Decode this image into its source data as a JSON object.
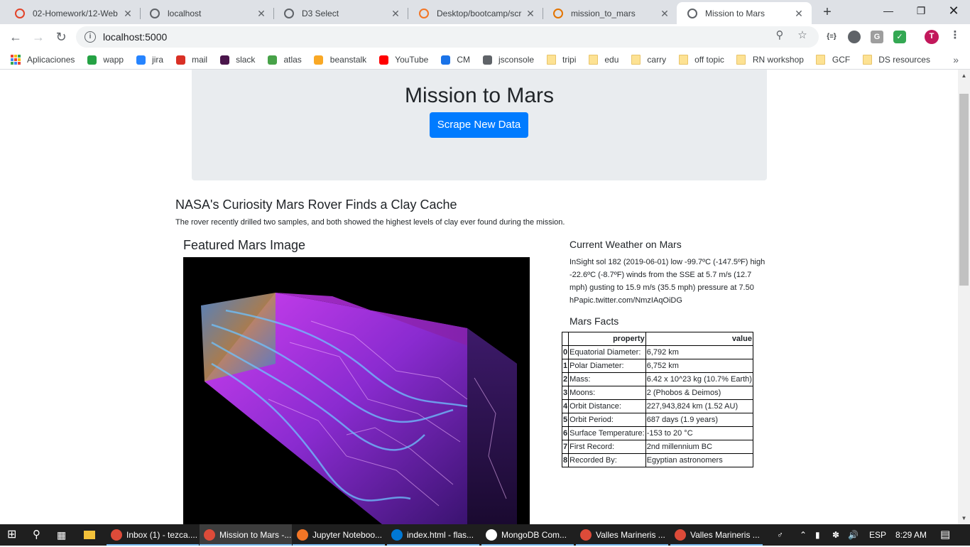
{
  "browser": {
    "tabs": [
      {
        "label": "02-Homework/12-Web",
        "icon": "gitlab-icon",
        "color": "#e24329"
      },
      {
        "label": "localhost",
        "icon": "globe-icon",
        "color": "#5f6368"
      },
      {
        "label": "D3 Select",
        "icon": "globe-icon",
        "color": "#5f6368"
      },
      {
        "label": "Desktop/bootcamp/scr",
        "icon": "jupyter-icon",
        "color": "#f37626"
      },
      {
        "label": "mission_to_mars",
        "icon": "notebook-icon",
        "color": "#e37400"
      },
      {
        "label": "Mission to Mars",
        "icon": "globe-icon",
        "color": "#5f6368"
      }
    ],
    "active_tab": 5,
    "url": "localhost:5000",
    "bookmarks": [
      {
        "label": "Aplicaciones",
        "icon": "apps-grid-icon",
        "color": "#4285f4"
      },
      {
        "label": "wapp",
        "icon": "whatsapp-icon",
        "color": "#25a244"
      },
      {
        "label": "jira",
        "icon": "jira-icon",
        "color": "#2684ff"
      },
      {
        "label": "mail",
        "icon": "gmail-icon",
        "color": "#d93025"
      },
      {
        "label": "slack",
        "icon": "slack-icon",
        "color": "#4a154b"
      },
      {
        "label": "atlas",
        "icon": "mongodb-leaf-icon",
        "color": "#47a248"
      },
      {
        "label": "beanstalk",
        "icon": "beanstalk-box-icon",
        "color": "#f9a825"
      },
      {
        "label": "YouTube",
        "icon": "youtube-icon",
        "color": "#ff0000"
      },
      {
        "label": "CM",
        "icon": "cm-icon",
        "color": "#1a73e8"
      },
      {
        "label": "jsconsole",
        "icon": "globe-icon",
        "color": "#5f6368"
      },
      {
        "label": "tripi",
        "icon": "folder-icon",
        "color": "#fde293"
      },
      {
        "label": "edu",
        "icon": "folder-icon",
        "color": "#fde293"
      },
      {
        "label": "carry",
        "icon": "folder-icon",
        "color": "#fde293"
      },
      {
        "label": "off topic",
        "icon": "folder-icon",
        "color": "#fde293"
      },
      {
        "label": "RN workshop",
        "icon": "folder-icon",
        "color": "#fde293"
      },
      {
        "label": "GCF",
        "icon": "folder-icon",
        "color": "#fde293"
      },
      {
        "label": "DS resources",
        "icon": "folder-icon",
        "color": "#fde293"
      }
    ],
    "profile_initial": "T"
  },
  "page": {
    "title": "Mission to Mars",
    "scrape_button": "Scrape New Data",
    "news_title": "NASA's Curiosity Mars Rover Finds a Clay Cache",
    "news_paragraph": "The rover recently drilled two samples, and both showed the highest levels of clay ever found during the mission.",
    "featured_heading": "Featured Mars Image",
    "weather_heading": "Current Weather on Mars",
    "weather_lines": [
      "InSight sol 182 (2019-06-01) low -99.7ºC (-147.5ºF) high",
      "-22.6ºC (-8.7ºF) winds from the SSE at 5.7 m/s (12.7",
      "mph) gusting to 15.9 m/s (35.5 mph) pressure at 7.50",
      "hPapic.twitter.com/NmzIAqOiDG"
    ],
    "facts_heading": "Mars Facts",
    "facts_columns": [
      "property",
      "value"
    ],
    "facts": [
      {
        "index": "0",
        "property": "Equatorial Diameter:",
        "value": "6,792 km"
      },
      {
        "index": "1",
        "property": "Polar Diameter:",
        "value": "6,752 km"
      },
      {
        "index": "2",
        "property": "Mass:",
        "value": "6.42 x 10^23 kg (10.7% Earth)"
      },
      {
        "index": "3",
        "property": "Moons:",
        "value": "2 (Phobos & Deimos)"
      },
      {
        "index": "4",
        "property": "Orbit Distance:",
        "value": "227,943,824 km (1.52 AU)"
      },
      {
        "index": "5",
        "property": "Orbit Period:",
        "value": "687 days (1.9 years)"
      },
      {
        "index": "6",
        "property": "Surface Temperature:",
        "value": "-153 to 20 °C"
      },
      {
        "index": "7",
        "property": "First Record:",
        "value": "2nd millennium BC"
      },
      {
        "index": "8",
        "property": "Recorded By:",
        "value": "Egyptian astronomers"
      }
    ]
  },
  "taskbar": {
    "items": [
      {
        "label": "Inbox (1) - tezca....",
        "icon": "chrome-icon",
        "color": "#dd4b39",
        "active": false
      },
      {
        "label": "Mission to Mars -...",
        "icon": "chrome-icon",
        "color": "#dd4b39",
        "active": true
      },
      {
        "label": "Jupyter Noteboo...",
        "icon": "jupyter-icon",
        "color": "#f37626",
        "active": false
      },
      {
        "label": "index.html - flas...",
        "icon": "vscode-icon",
        "color": "#0078d4",
        "active": false
      },
      {
        "label": "MongoDB Com...",
        "icon": "mongodb-icon",
        "color": "#ffffff",
        "active": false
      },
      {
        "label": "Valles Marineris ...",
        "icon": "chrome-icon",
        "color": "#dd4b39",
        "active": false
      },
      {
        "label": "Valles Marineris ...",
        "icon": "chrome-icon",
        "color": "#dd4b39",
        "active": false
      }
    ],
    "language": "ESP",
    "time": "8:29 AM"
  }
}
